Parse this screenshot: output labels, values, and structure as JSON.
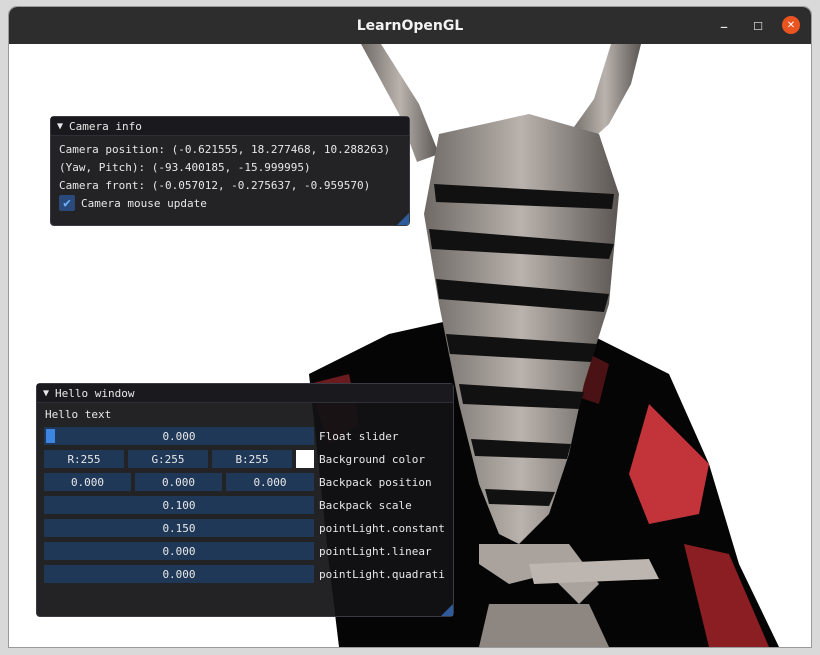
{
  "window": {
    "title": "LearnOpenGL",
    "min_glyph": "–",
    "max_glyph": "☐",
    "close_glyph": "✕",
    "close_color": "#e95420"
  },
  "camera_panel": {
    "header": "Camera info",
    "position_line": "Camera position: (-0.621555, 18.277468, 10.288263)",
    "yawpitch_line": "(Yaw, Pitch): (-93.400185, -15.999995)",
    "front_line": "Camera front: (-0.057012, -0.275637, -0.959570)",
    "mouse_update_label": "Camera mouse update",
    "mouse_update_checked": true
  },
  "hello_panel": {
    "header": "Hello window",
    "text": "Hello text",
    "float_slider": {
      "value": "0.000",
      "label": "Float slider",
      "fraction": 0.0
    },
    "background_color": {
      "r": "R:255",
      "g": "G:255",
      "b": "B:255",
      "label": "Background color",
      "swatch": "#ffffff"
    },
    "backpack_position": {
      "x": "0.000",
      "y": "0.000",
      "z": "0.000",
      "label": "Backpack position"
    },
    "backpack_scale": {
      "value": "0.100",
      "label": "Backpack scale"
    },
    "pointlight_constant": {
      "value": "0.150",
      "label": "pointLight.constant"
    },
    "pointlight_linear": {
      "value": "0.000",
      "label": "pointLight.linear"
    },
    "pointlight_quadratic": {
      "value": "0.000",
      "label": "pointLight.quadrati"
    }
  },
  "colors": {
    "panel_bg": "#121214",
    "field_bg": "#1f3858",
    "accent": "#3d85e0"
  },
  "icons": [
    "collapse-triangle-icon",
    "checkmark-icon",
    "minimize-icon",
    "maximize-icon",
    "close-icon"
  ]
}
